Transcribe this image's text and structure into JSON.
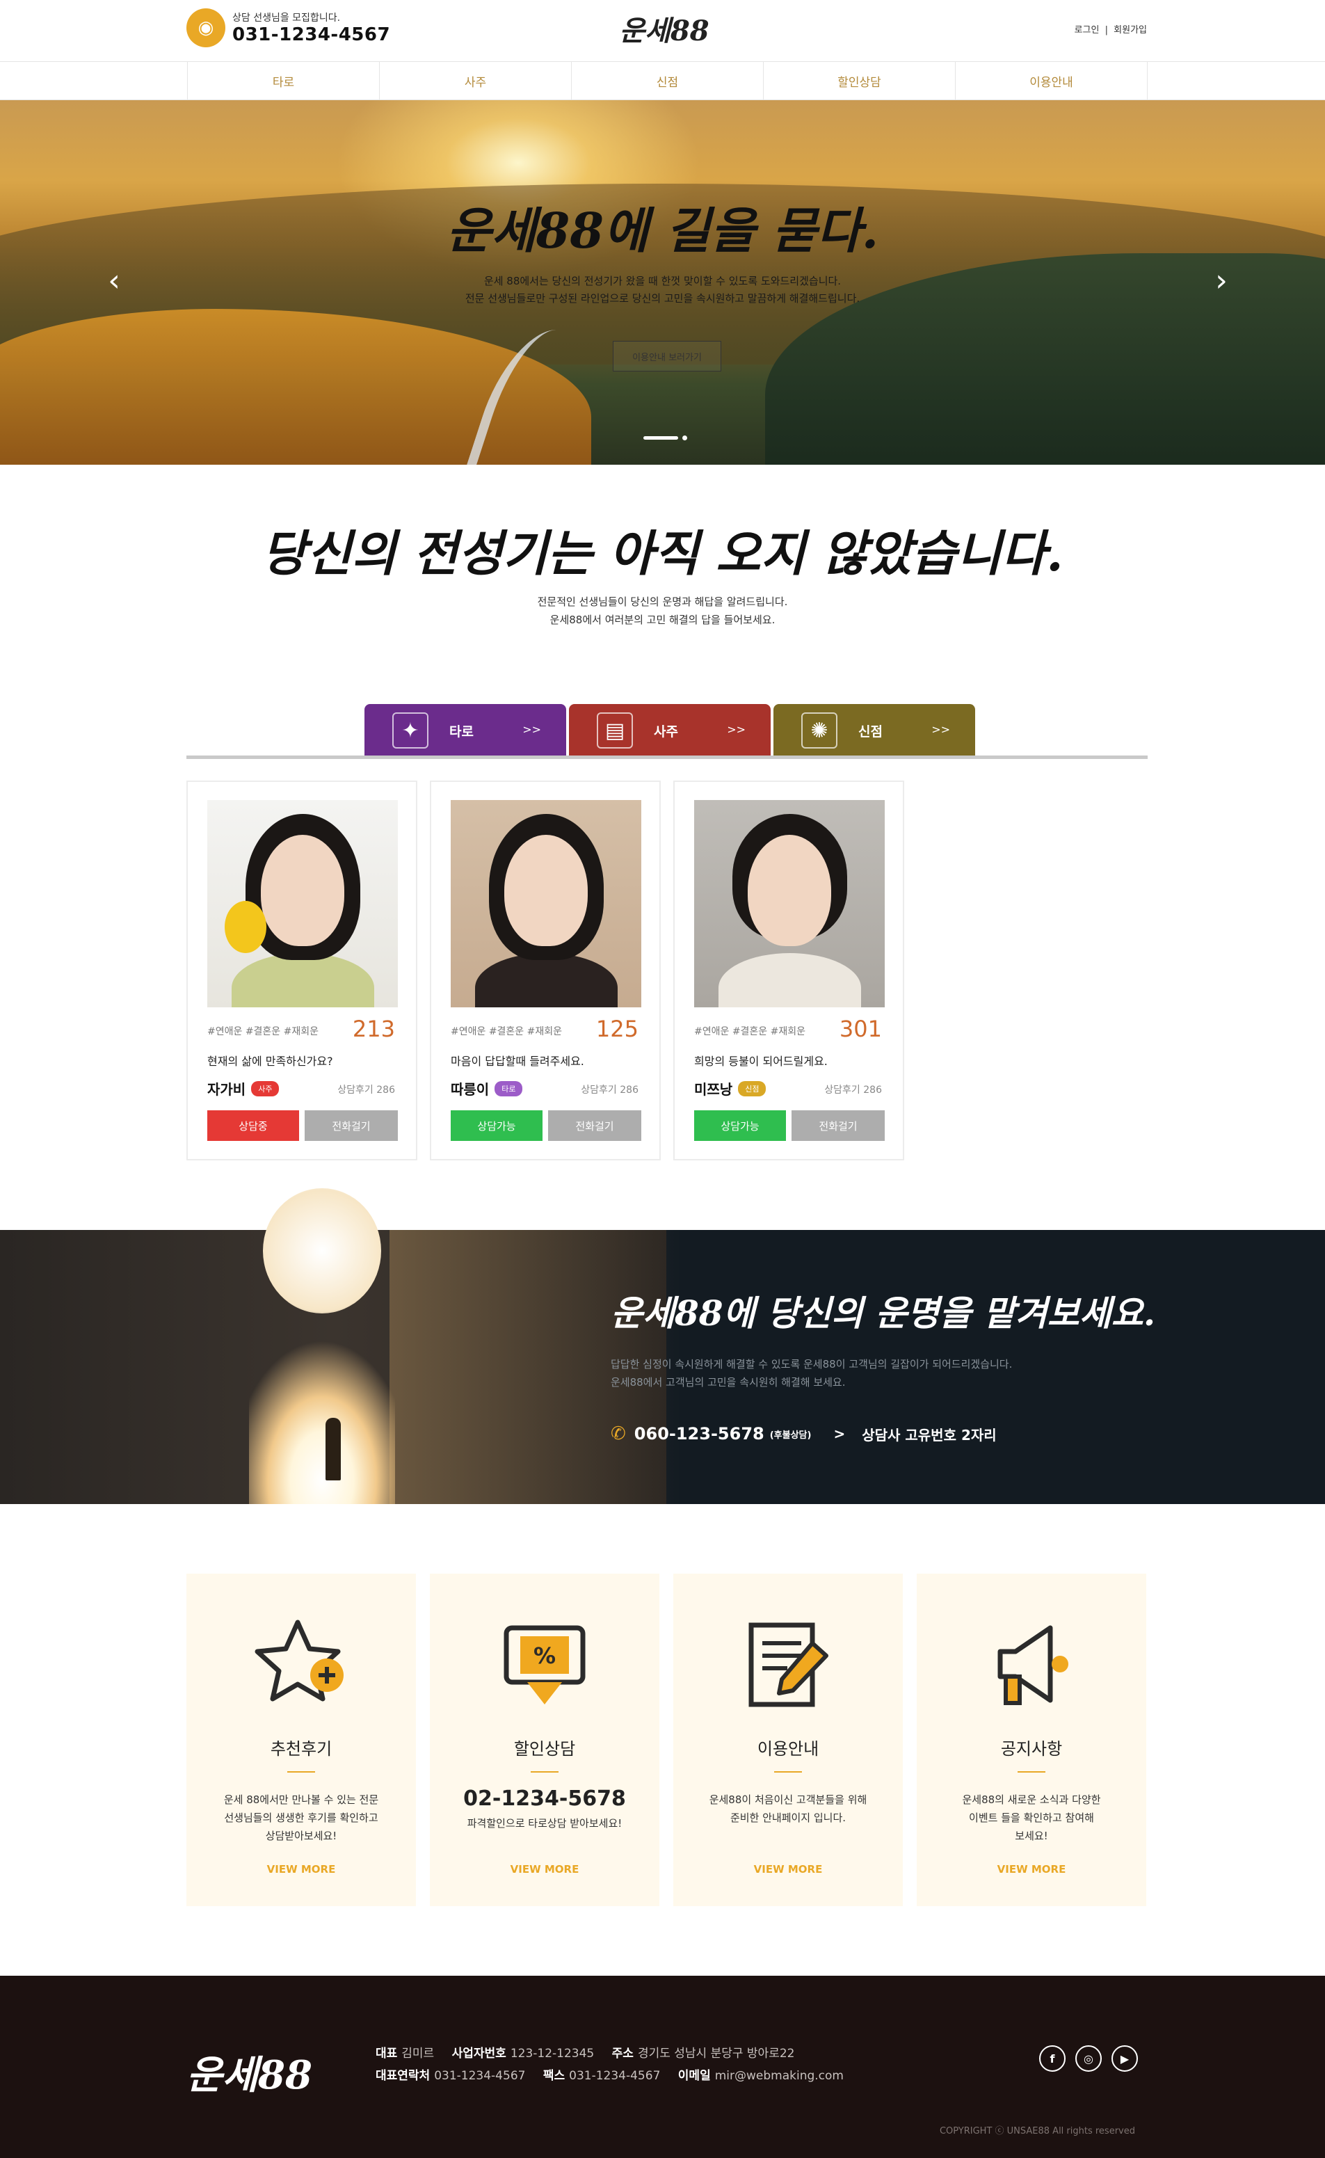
{
  "header": {
    "recruit_text": "상담 선생님을 모집합니다.",
    "phone": "031-1234-4567",
    "brand": "운세88",
    "login": "로그인",
    "separator": "|",
    "signup": "회원가입"
  },
  "nav": {
    "items": [
      "타로",
      "사주",
      "신점",
      "할인상담",
      "이용안내"
    ]
  },
  "hero": {
    "title": "운세88에 길을 묻다.",
    "line1": "운세 88에서는 당신의 전성기가 왔을 때 한껏 맞이할 수 있도록 도와드리겠습니다.",
    "line2": "전문 선생님들로만 구성된 라인업으로 당신의 고민을 속시원하고 말끔하게 해결해드립니다.",
    "button": "이용안내 보러가기",
    "prev": "‹",
    "next": "›"
  },
  "intro": {
    "title": "당신의 전성기는 아직 오지 않았습니다.",
    "line1": "전문적인 선생님들이 당신의 운명과 해답을 알려드립니다.",
    "line2": "운세88에서 여러분의 고민 해결의 답을 들어보세요."
  },
  "tabs": [
    {
      "label": "타로",
      "arrow": ">>",
      "color": "#6b2c8c"
    },
    {
      "label": "사주",
      "arrow": ">>",
      "color": "#a8332b"
    },
    {
      "label": "신점",
      "arrow": ">>",
      "color": "#7b6a22"
    }
  ],
  "counselors": [
    {
      "tags": "#연애운 #결혼운 #재회운",
      "count": "213",
      "text": "현재의 삶에 만족하신가요?",
      "name": "자가비",
      "badge": "사주",
      "badge_color": "#e53935",
      "review": "상담후기 286",
      "status": "상담중",
      "status_color": "#e53935",
      "call": "전화걸기"
    },
    {
      "tags": "#연애운 #결혼운 #재회운",
      "count": "125",
      "text": "마음이 답답할때 들려주세요.",
      "name": "따릉이",
      "badge": "타로",
      "badge_color": "#9c5cc8",
      "review": "상담후기 286",
      "status": "상담가능",
      "status_color": "#2fbe4f",
      "call": "전화걸기"
    },
    {
      "tags": "#연애운 #결혼운 #재회운",
      "count": "301",
      "text": "희망의 등불이 되어드릴게요.",
      "name": "미쯔낭",
      "badge": "신점",
      "badge_color": "#d9a826",
      "review": "상담후기 286",
      "status": "상담가능",
      "status_color": "#2fbe4f",
      "call": "전화걸기"
    }
  ],
  "banner": {
    "title": "운세88에 당신의 운명을 맡겨보세요.",
    "line1": "답답한 심정이 속시원하게 해결할 수 있도록 운세88이 고객님의 길잡이가 되어드리겠습니다.",
    "line2": "운세88에서 고객님의 고민을 속시원히 해결해 보세요.",
    "phone": "060-123-5678",
    "phone_note": "(후불상담)",
    "arrow": ">",
    "code_text": "상담사 고유번호 2자리"
  },
  "features": [
    {
      "title": "추천후기",
      "desc1": "운세 88에서만 만나볼 수 있는 전문",
      "desc2": "선생님들의 생생한 후기를 확인하고",
      "desc3": "상담받아보세요!",
      "more": "VIEW MORE",
      "icon": "star-plus-icon"
    },
    {
      "title": "할인상담",
      "phone": "02-1234-5678",
      "desc1": "파격할인으로 타로상담 받아보세요!",
      "more": "VIEW MORE",
      "icon": "discount-ticket-icon"
    },
    {
      "title": "이용안내",
      "desc1": "운세88이 처음이신 고객분들을 위해",
      "desc2": "준비한 안내페이지 입니다.",
      "more": "VIEW MORE",
      "icon": "document-pencil-icon"
    },
    {
      "title": "공지사항",
      "desc1": "운세88의 새로운 소식과 다양한",
      "desc2": "이벤트 들을 확인하고 참여해",
      "desc3": "보세요!",
      "more": "VIEW MORE",
      "icon": "megaphone-icon"
    }
  ],
  "footer": {
    "brand": "운세88",
    "ceo_label": "대표",
    "ceo": "김미르",
    "biz_label": "사업자번호",
    "biz": "123-12-12345",
    "addr_label": "주소",
    "addr": "경기도 성남시 분당구 방아로22",
    "tel_label": "대표연락처",
    "tel": "031-1234-4567",
    "fax_label": "팩스",
    "fax": "031-1234-4567",
    "email_label": "이메일",
    "email": "mir@webmaking.com",
    "social": [
      "f",
      "◎",
      "▶"
    ],
    "copyright": "COPYRIGHT ⓒ UNSAE88 All rights reserved"
  },
  "colors": {
    "accent": "#e9a826",
    "nav_text": "#b38a3a",
    "footer_bg": "#1c1110",
    "banner_bg": "#131b22"
  }
}
